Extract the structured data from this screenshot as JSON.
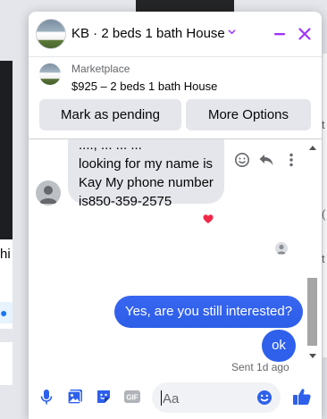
{
  "background": {
    "left_text": "hi",
    "right_texts": [
      "t",
      "(",
      "t"
    ]
  },
  "chat": {
    "title": "KB · 2 beds 1 bath House",
    "accent": "#a033ff",
    "listing": {
      "label": "Marketplace",
      "title": "$925 – 2 beds 1 bath House"
    },
    "buttons": {
      "mark_pending": "Mark as pending",
      "more_options": "More Options"
    },
    "messages": {
      "incoming_text": "...., ... ... ...\nlooking for my name is\nKay My phone number\nis850-359-2575",
      "reaction": "heart",
      "outgoing": [
        "Yes, are you still interested?",
        "ok"
      ],
      "status": "Sent 1d ago"
    },
    "composer": {
      "placeholder": "Aa",
      "icons": [
        "microphone-icon",
        "photo-icon",
        "sticker-icon",
        "gif-icon",
        "emoji-icon",
        "thumbs-up-icon"
      ],
      "gif_label": "GIF"
    }
  }
}
